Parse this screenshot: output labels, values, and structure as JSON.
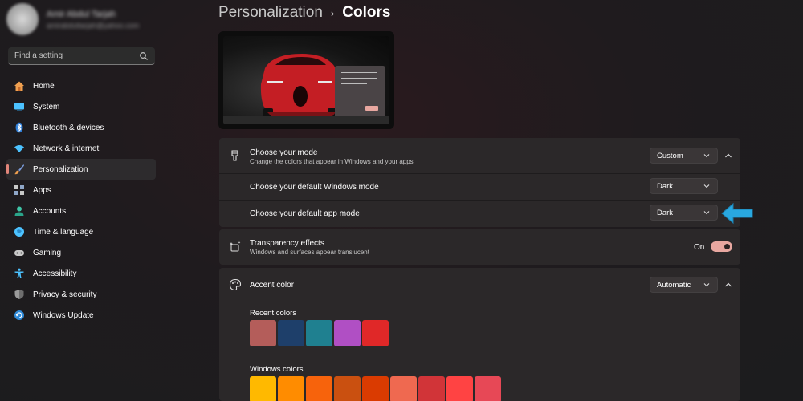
{
  "sidebar": {
    "profile": {
      "name": "Amir Abdul Tarjah",
      "email": "amirabdultarjah@yahoo.com"
    },
    "search_placeholder": "Find a setting",
    "items": [
      {
        "label": "Home",
        "icon": "home-icon",
        "color": "#f0a050"
      },
      {
        "label": "System",
        "icon": "system-icon",
        "color": "#4cc2ff"
      },
      {
        "label": "Bluetooth & devices",
        "icon": "bluetooth-icon",
        "color": "#4cc2ff"
      },
      {
        "label": "Network & internet",
        "icon": "network-icon",
        "color": "#4cc2ff"
      },
      {
        "label": "Personalization",
        "icon": "brush-icon",
        "color": "#e8a050",
        "active": true
      },
      {
        "label": "Apps",
        "icon": "apps-icon",
        "color": "#c8c8c8"
      },
      {
        "label": "Accounts",
        "icon": "accounts-icon",
        "color": "#3fc6a8"
      },
      {
        "label": "Time & language",
        "icon": "time-language-icon",
        "color": "#4cc2ff"
      },
      {
        "label": "Gaming",
        "icon": "gaming-icon",
        "color": "#c8c8c8"
      },
      {
        "label": "Accessibility",
        "icon": "accessibility-icon",
        "color": "#4cc2ff"
      },
      {
        "label": "Privacy & security",
        "icon": "shield-icon",
        "color": "#9a9a9a"
      },
      {
        "label": "Windows Update",
        "icon": "update-icon",
        "color": "#4cc2ff"
      }
    ]
  },
  "breadcrumb": {
    "parent": "Personalization",
    "separator": "›",
    "current": "Colors"
  },
  "mode_card": {
    "title": "Choose your mode",
    "subtitle": "Change the colors that appear in Windows and your apps",
    "value": "Custom",
    "windows_mode": {
      "label": "Choose your default Windows mode",
      "value": "Dark"
    },
    "app_mode": {
      "label": "Choose your default app mode",
      "value": "Dark"
    }
  },
  "transparency": {
    "title": "Transparency effects",
    "subtitle": "Windows and surfaces appear translucent",
    "state_label": "On",
    "enabled": true
  },
  "accent": {
    "title": "Accent color",
    "value": "Automatic",
    "recent_label": "Recent colors",
    "recent_colors": [
      "#b45d5a",
      "#1e3f6a",
      "#1f8090",
      "#b04fc4",
      "#e02828"
    ],
    "windows_label": "Windows colors",
    "windows_colors": [
      "#ffb900",
      "#ff8c00",
      "#f7630c",
      "#ca5010",
      "#da3b01",
      "#ef6950",
      "#d13438",
      "#ff4343",
      "#e74856"
    ]
  },
  "colors": {
    "accent_pink": "#e8a7a0",
    "annotation_arrow": "#29a8e0"
  }
}
